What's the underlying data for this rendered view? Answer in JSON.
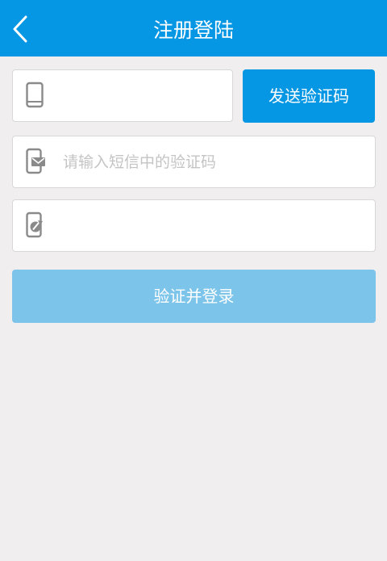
{
  "header": {
    "title": "注册登陆",
    "back_icon": "chevron-left-icon",
    "background": "#0596e4"
  },
  "phone": {
    "value": "",
    "placeholder": "",
    "icon": "phone-icon"
  },
  "send_code": {
    "label": "发送验证码",
    "color": "#0596e4"
  },
  "code": {
    "value": "",
    "placeholder": "请输入短信中的验证码",
    "icon": "sms-code-icon"
  },
  "invite": {
    "value": "",
    "placeholder": "",
    "icon": "edit-document-icon"
  },
  "submit": {
    "label": "验证并登录",
    "color": "#7cc4ea"
  }
}
